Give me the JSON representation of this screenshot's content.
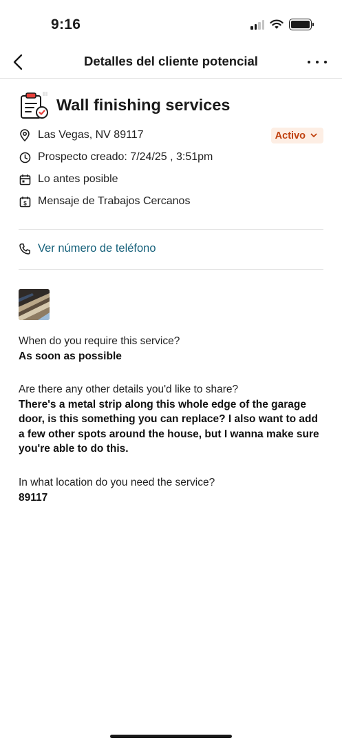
{
  "status_bar": {
    "time": "9:16"
  },
  "nav": {
    "title": "Detalles del cliente potencial"
  },
  "lead": {
    "title": "Wall finishing services",
    "location": "Las Vegas, NV 89117",
    "created": "Prospecto creado: 7/24/25 , 3:51pm",
    "timing": "Lo antes posible",
    "source": "Mensaje de Trabajos Cercanos",
    "status": "Activo",
    "status_color": "#c0410f",
    "status_bg": "#fdeee4"
  },
  "contact": {
    "phone_link": "Ver número de teléfono",
    "link_color": "#15607a"
  },
  "questions": [
    {
      "question": "When do you require this service?",
      "answer": "As soon as possible"
    },
    {
      "question": "Are there any other details you'd like to share?",
      "answer": "There's a metal strip along this whole edge of the garage door, is this something you can replace? I also want to add a few other spots around the house, but I wanna make sure you're able to do this."
    },
    {
      "question": "In what location do you need the service?",
      "answer": "89117"
    }
  ],
  "icons": {
    "back": "chevron-left-icon",
    "more": "more-horizontal-icon",
    "lead_type": "clipboard-check-icon",
    "location": "map-pin-icon",
    "created": "clock-icon",
    "timing": "calendar-icon",
    "source": "dollar-calendar-icon",
    "phone": "phone-icon",
    "badge_chevron": "chevron-down-icon"
  }
}
